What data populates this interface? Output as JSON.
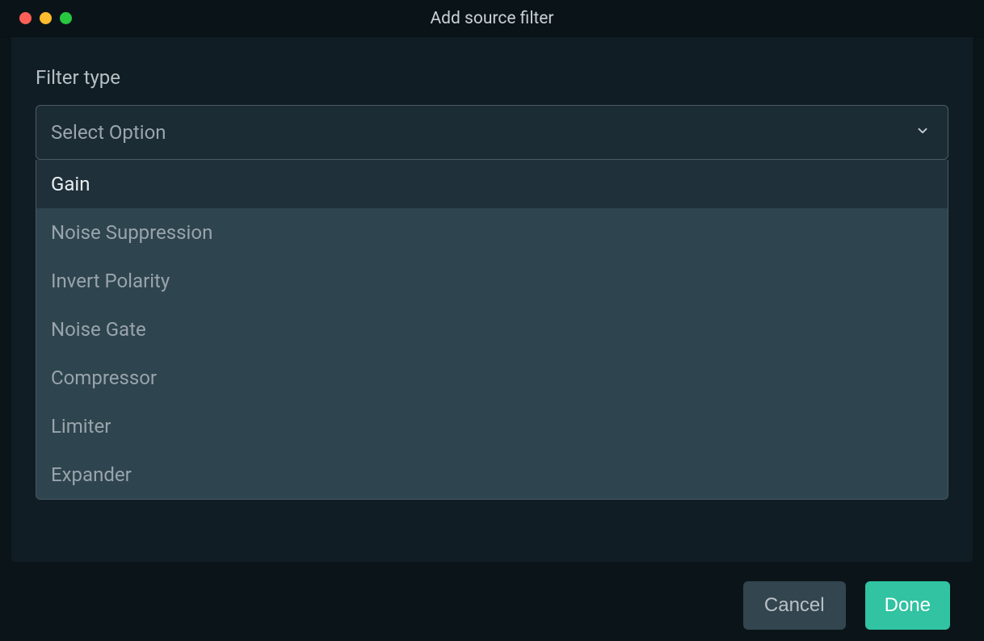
{
  "titlebar": {
    "title": "Add source filter"
  },
  "form": {
    "filter_type_label": "Filter type",
    "select_placeholder": "Select Option",
    "options": [
      "Gain",
      "Noise Suppression",
      "Invert Polarity",
      "Noise Gate",
      "Compressor",
      "Limiter",
      "Expander"
    ],
    "active_option_index": 0
  },
  "buttons": {
    "cancel": "Cancel",
    "done": "Done"
  },
  "colors": {
    "accent": "#31c3a2",
    "dialog_bg": "#101d24",
    "dropdown_bg": "#2e444f",
    "select_bg": "#1b2c35"
  }
}
